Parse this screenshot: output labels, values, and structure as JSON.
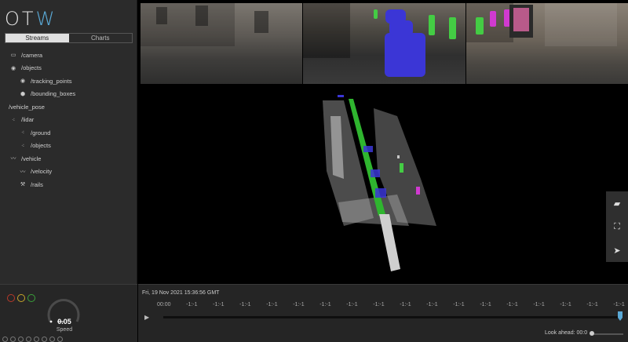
{
  "app": {
    "logo_text": "OT",
    "logo_accent": "W"
  },
  "tabs": [
    {
      "label": "Streams",
      "active": true
    },
    {
      "label": "Charts",
      "active": false
    }
  ],
  "streams": [
    {
      "label": "/camera",
      "icon": "camera-icon",
      "level": 0
    },
    {
      "label": "/objects",
      "icon": "toggle-icon",
      "level": 0
    },
    {
      "label": "/tracking_points",
      "icon": "toggle-icon",
      "level": 1
    },
    {
      "label": "/bounding_boxes",
      "icon": "cube-icon",
      "level": 1
    },
    {
      "label": "/vehicle_pose",
      "icon": "",
      "level": 0
    },
    {
      "label": "/lidar",
      "icon": "points-icon",
      "level": 0
    },
    {
      "label": "/ground",
      "icon": "points-icon",
      "level": 1
    },
    {
      "label": "/objects",
      "icon": "points-icon",
      "level": 1
    },
    {
      "label": "/vehicle",
      "icon": "line-chart-icon",
      "level": 0
    },
    {
      "label": "/velocity",
      "icon": "line-chart-icon",
      "level": 1
    },
    {
      "label": "/rails",
      "icon": "wrench-icon",
      "level": 1
    }
  ],
  "hud": {
    "speed_value": "0.05",
    "speed_label": "Speed",
    "traffic_light_colors": [
      "#b83a2a",
      "#c8a52a",
      "#3aa13a"
    ]
  },
  "timeline": {
    "timestamp": "Fri, 19 Nov 2021 15:36:56 GMT",
    "start_label": "00:00",
    "tick_labels": [
      "-1:-1",
      "-1:-1",
      "-1:-1",
      "-1:-1",
      "-1:-1",
      "-1:-1",
      "-1:-1",
      "-1:-1",
      "-1:-1",
      "-1:-1",
      "-1:-1",
      "-1:-1",
      "-1:-1",
      "-1:-1",
      "-1:-1",
      "-1:-1",
      "-1:-1"
    ],
    "look_ahead_label": "Look ahead: 00:0",
    "play_position_fraction": 1.0
  },
  "colors": {
    "accent": "#5aa9d6",
    "tracked_blue": "#3b36d6",
    "vehicle_path_green": "#2fb52f",
    "pedestrian_green": "#44cc44",
    "pedestrian_magenta": "#d03ad0"
  }
}
